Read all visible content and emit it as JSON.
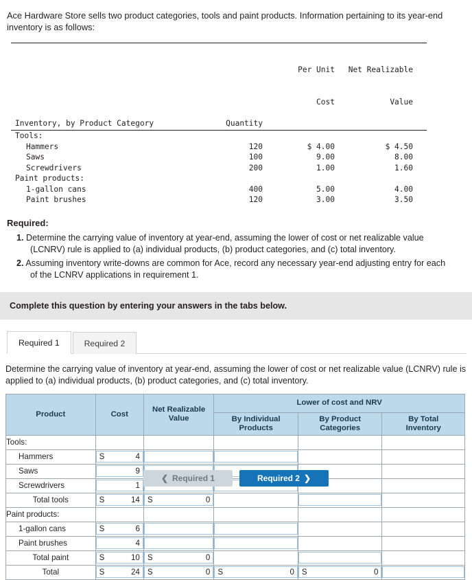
{
  "intro": "Ace Hardware Store sells two product categories, tools and paint products. Information pertaining to its year-end inventory is as follows:",
  "data_table": {
    "headers": {
      "category": "Inventory, by Product Category",
      "quantity": "Quantity",
      "per_unit_cost_line1": "Per Unit",
      "per_unit_cost_line2": "Cost",
      "nrv_line1": "Net Realizable",
      "nrv_line2": "Value"
    },
    "rows": [
      {
        "label": "Tools:",
        "indent": 0,
        "quantity": "",
        "cost": "",
        "nrv": ""
      },
      {
        "label": "Hammers",
        "indent": 1,
        "quantity": "120",
        "cost": "$ 4.00",
        "nrv": "$ 4.50"
      },
      {
        "label": "Saws",
        "indent": 1,
        "quantity": "100",
        "cost": "9.00",
        "nrv": "8.00"
      },
      {
        "label": "Screwdrivers",
        "indent": 1,
        "quantity": "200",
        "cost": "1.00",
        "nrv": "1.60"
      },
      {
        "label": "Paint products:",
        "indent": 0,
        "quantity": "",
        "cost": "",
        "nrv": ""
      },
      {
        "label": "1-gallon cans",
        "indent": 1,
        "quantity": "400",
        "cost": "5.00",
        "nrv": "4.00"
      },
      {
        "label": "Paint brushes",
        "indent": 1,
        "quantity": "120",
        "cost": "3.00",
        "nrv": "3.50"
      }
    ]
  },
  "required": {
    "title": "Required:",
    "item1_num": "1.",
    "item1_line1": "Determine the carrying value of inventory at year-end, assuming the lower of cost or net realizable value",
    "item1_line2": "(LCNRV) rule is applied to (a) individual products, (b) product categories, and (c) total inventory.",
    "item2_num": "2.",
    "item2_line1": "Assuming inventory write-downs are common for Ace, record any necessary year-end adjusting entry for each",
    "item2_line2": "of the LCNRV applications in requirement 1."
  },
  "banner": "Complete this question by entering your answers in the tabs below.",
  "tabs": [
    {
      "label": "Required 1",
      "active": true
    },
    {
      "label": "Required 2",
      "active": false
    }
  ],
  "prompt_line1": "Determine the carrying value of inventory at year-end, assuming the lower of cost or net realizable value (LCNRV) rule is",
  "prompt_line2": "applied to (a) individual products, (b) product categories, and (c) total inventory.",
  "answer_grid": {
    "headers": {
      "product": "Product",
      "cost": "Cost",
      "nrv_line1": "Net Realizable",
      "nrv_line2": "Value",
      "group": "Lower of cost and NRV",
      "by_individual_line1": "By Individual",
      "by_individual_line2": "Products",
      "by_product_line1": "By Product",
      "by_product_line2": "Categories",
      "by_total_line1": "By Total",
      "by_total_line2": "Inventory"
    },
    "rows": [
      {
        "label": "Tools:",
        "type": "section",
        "indent": 0
      },
      {
        "label": "Hammers",
        "type": "input",
        "indent": 1,
        "cost_dollar": "S",
        "cost_val": "4",
        "nrv_box": true,
        "nrv_dollar": "",
        "nrv_val": "",
        "ind_box": true,
        "ind_dollar": "",
        "ind_val": "",
        "cat_box": false,
        "tot_box": false
      },
      {
        "label": "Saws",
        "type": "input",
        "indent": 1,
        "cost_dollar": "",
        "cost_val": "9",
        "nrv_box": true,
        "nrv_dollar": "",
        "nrv_val": "",
        "ind_box": true,
        "ind_dollar": "",
        "ind_val": "",
        "cat_box": false,
        "tot_box": false
      },
      {
        "label": "Screwdrivers",
        "type": "input",
        "indent": 1,
        "cost_dollar": "",
        "cost_val": "1",
        "nrv_box": true,
        "nrv_dollar": "",
        "nrv_val": "",
        "ind_box": true,
        "ind_dollar": "",
        "ind_val": "",
        "cat_box": false,
        "tot_box": false
      },
      {
        "label": "Total tools",
        "type": "total",
        "indent": 2,
        "cost_dollar": "S",
        "cost_val": "14",
        "nrv_box": true,
        "nrv_dollar": "S",
        "nrv_val": "0",
        "ind_box": false,
        "cat_box": true,
        "cat_dollar": "",
        "cat_val": "",
        "tot_box": false
      },
      {
        "label": "Paint products:",
        "type": "section",
        "indent": 0
      },
      {
        "label": "1-gallon cans",
        "type": "input",
        "indent": 1,
        "cost_dollar": "S",
        "cost_val": "6",
        "nrv_box": true,
        "nrv_dollar": "",
        "nrv_val": "",
        "ind_box": true,
        "ind_dollar": "",
        "ind_val": "",
        "cat_box": false,
        "tot_box": false
      },
      {
        "label": "Paint brushes",
        "type": "input",
        "indent": 1,
        "cost_dollar": "",
        "cost_val": "4",
        "nrv_box": true,
        "nrv_dollar": "",
        "nrv_val": "",
        "ind_box": true,
        "ind_dollar": "",
        "ind_val": "",
        "cat_box": false,
        "tot_box": false
      },
      {
        "label": "Total paint",
        "type": "total",
        "indent": 2,
        "cost_dollar": "S",
        "cost_val": "10",
        "nrv_box": true,
        "nrv_dollar": "S",
        "nrv_val": "0",
        "ind_box": false,
        "cat_box": true,
        "cat_dollar": "",
        "cat_val": "",
        "tot_box": false
      },
      {
        "label": "Total",
        "type": "total",
        "indent": 2,
        "cost_dollar": "S",
        "cost_val": "24",
        "nrv_box": true,
        "nrv_dollar": "S",
        "nrv_val": "0",
        "ind_box": true,
        "ind_dollar": "S",
        "ind_val": "0",
        "cat_box": true,
        "cat_dollar": "S",
        "cat_val": "0",
        "tot_box": true
      }
    ]
  },
  "nav": {
    "prev_label": "Required 1",
    "prev_icon": "chevron-left-icon",
    "next_label": "Required 2",
    "next_icon": "chevron-right-icon"
  }
}
